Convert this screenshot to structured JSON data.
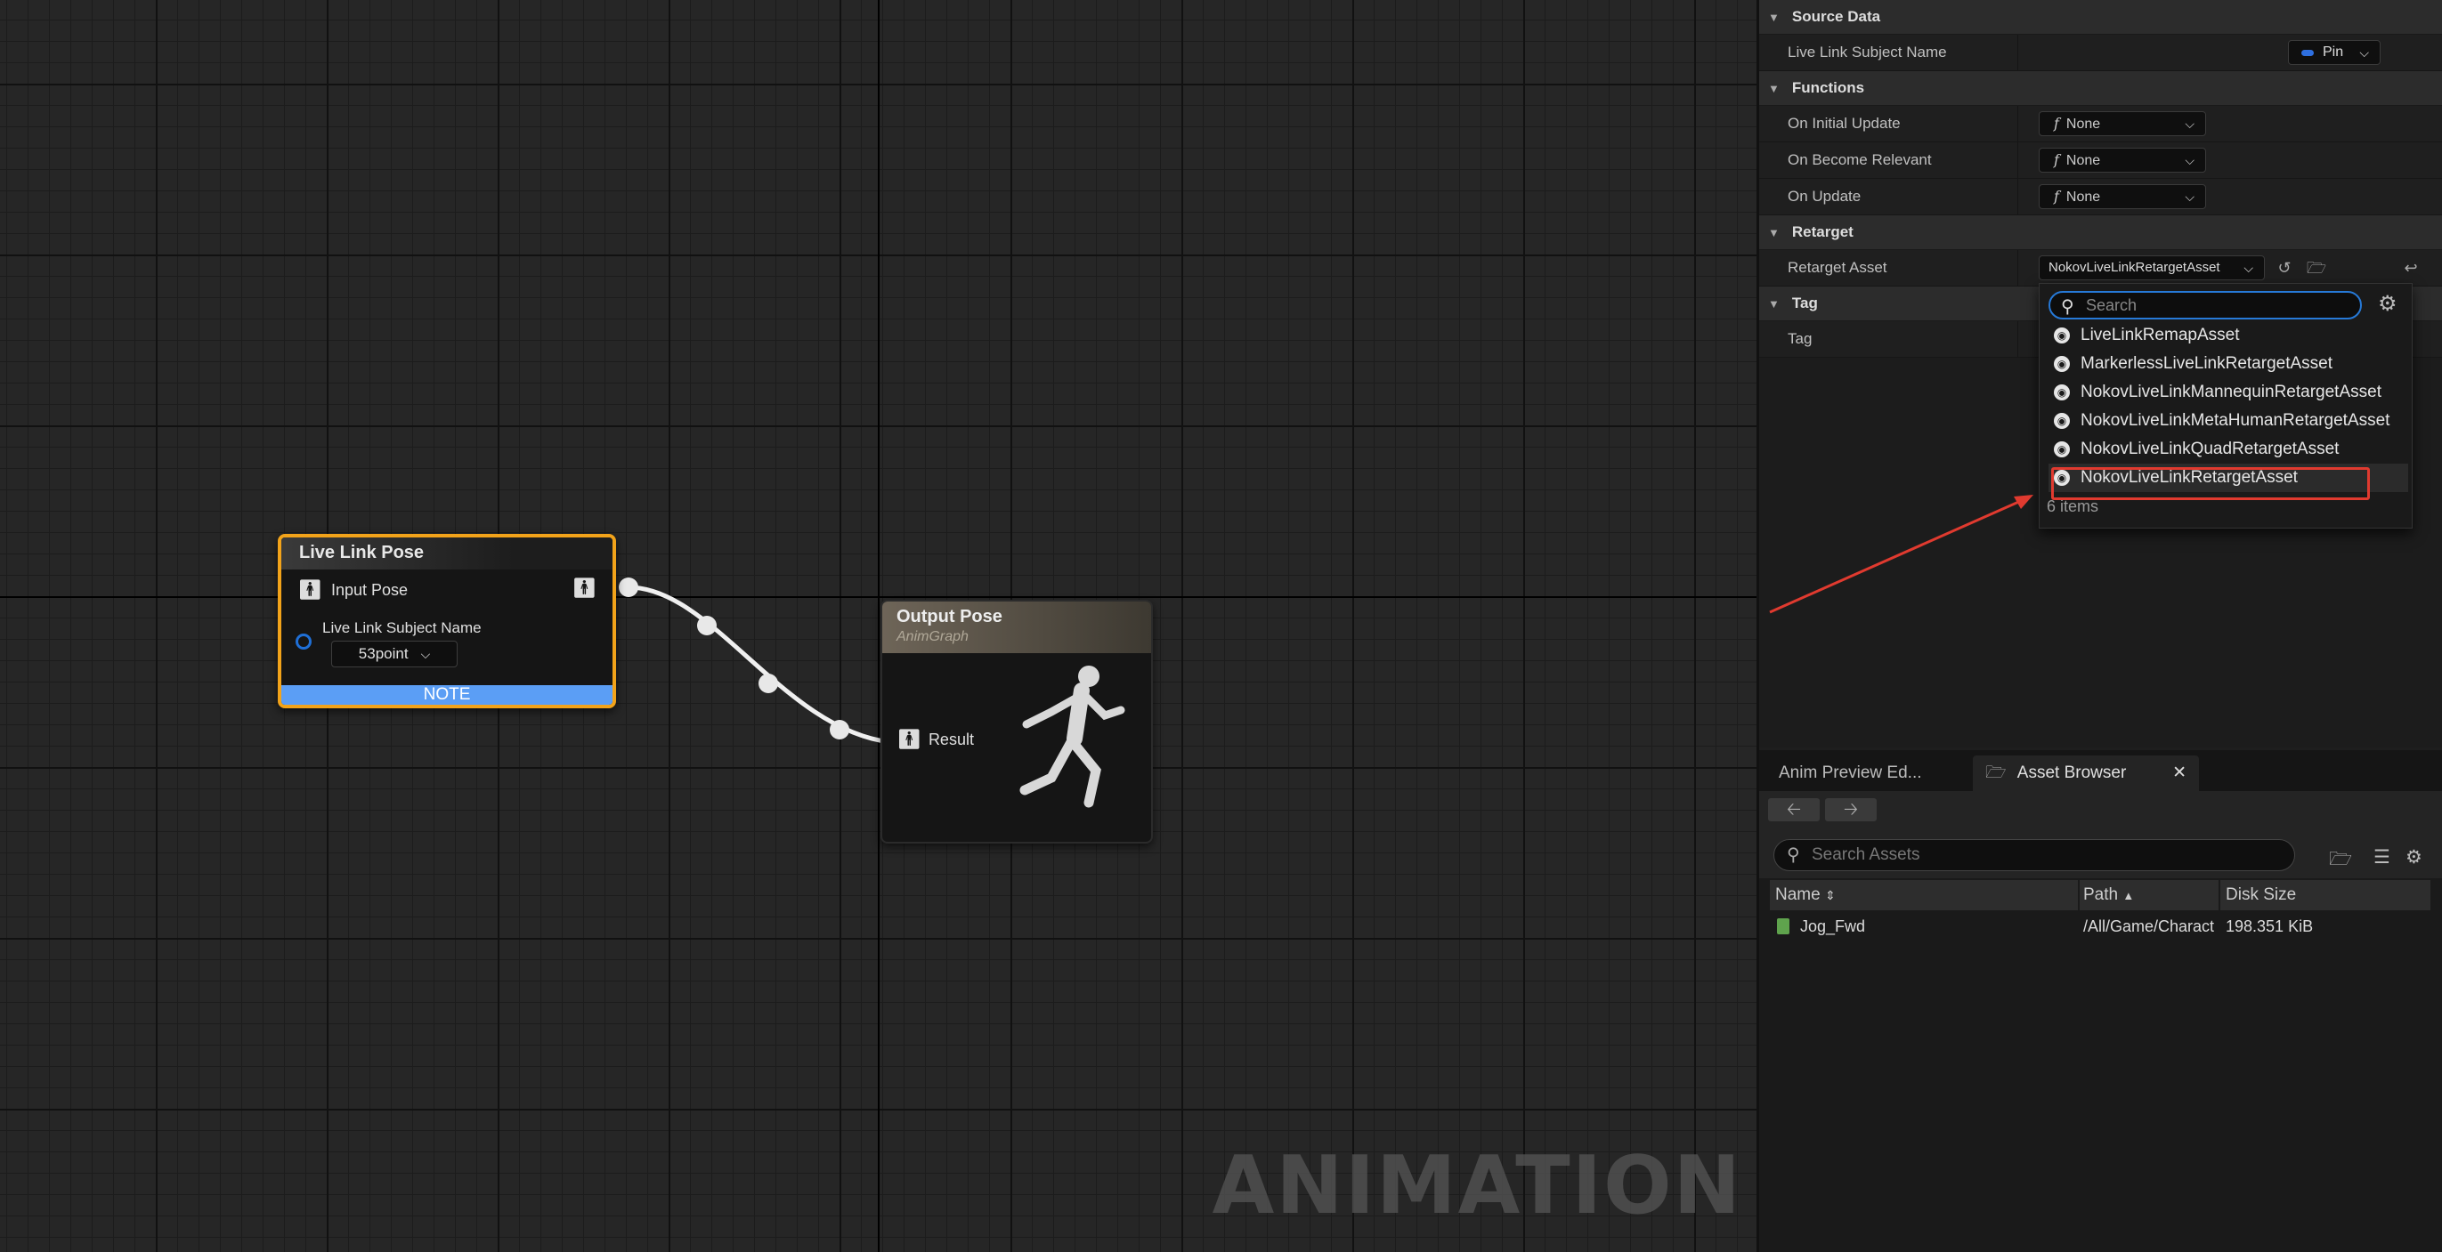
{
  "graph": {
    "watermark": "ANIMATION",
    "live_link_node": {
      "title": "Live Link Pose",
      "input_pose_label": "Input Pose",
      "subject_name_label": "Live Link Subject Name",
      "subject_value": "53point",
      "note": "NOTE"
    },
    "output_node": {
      "title": "Output Pose",
      "subtitle": "AnimGraph",
      "result_label": "Result"
    }
  },
  "details": {
    "source_data": {
      "category": "Source Data",
      "subject_label": "Live Link Subject Name",
      "pin_value": "Pin"
    },
    "functions": {
      "category": "Functions",
      "rows": [
        {
          "label": "On Initial Update",
          "value": "None"
        },
        {
          "label": "On Become Relevant",
          "value": "None"
        },
        {
          "label": "On Update",
          "value": "None"
        }
      ]
    },
    "retarget": {
      "category": "Retarget",
      "asset_label": "Retarget Asset",
      "asset_value": "NokovLiveLinkRetargetAsset"
    },
    "tag": {
      "category": "Tag",
      "tag_label": "Tag"
    }
  },
  "popup": {
    "search_placeholder": "Search",
    "items": [
      "LiveLinkRemapAsset",
      "MarkerlessLiveLinkRetargetAsset",
      "NokovLiveLinkMannequinRetargetAsset",
      "NokovLiveLinkMetaHumanRetargetAsset",
      "NokovLiveLinkQuadRetargetAsset",
      "NokovLiveLinkRetargetAsset"
    ],
    "selected_index": 5,
    "count": "6 items"
  },
  "bottom": {
    "tabs": [
      "Anim Preview Ed...",
      "Asset Browser"
    ],
    "search_placeholder": "Search Assets",
    "columns": [
      "Name",
      "Path",
      "Disk Size"
    ],
    "rows": [
      {
        "name": "Jog_Fwd",
        "path": "/All/Game/Charact",
        "size": "198.351 KiB"
      }
    ]
  },
  "colors": {
    "selection_outline": "#f2a31a",
    "note_bar": "#5b9ef5",
    "highlight_annotation": "#e03a2f",
    "search_focus": "#2679d7"
  },
  "icons": [
    "pose-icon",
    "link-pin-icon",
    "chevron-down-icon",
    "function-icon",
    "browse-icon",
    "reset-icon",
    "search-icon",
    "gear-icon",
    "asset-icon",
    "close-icon",
    "arrow-left-icon",
    "arrow-right-icon",
    "folder-icon",
    "filter-icon"
  ]
}
